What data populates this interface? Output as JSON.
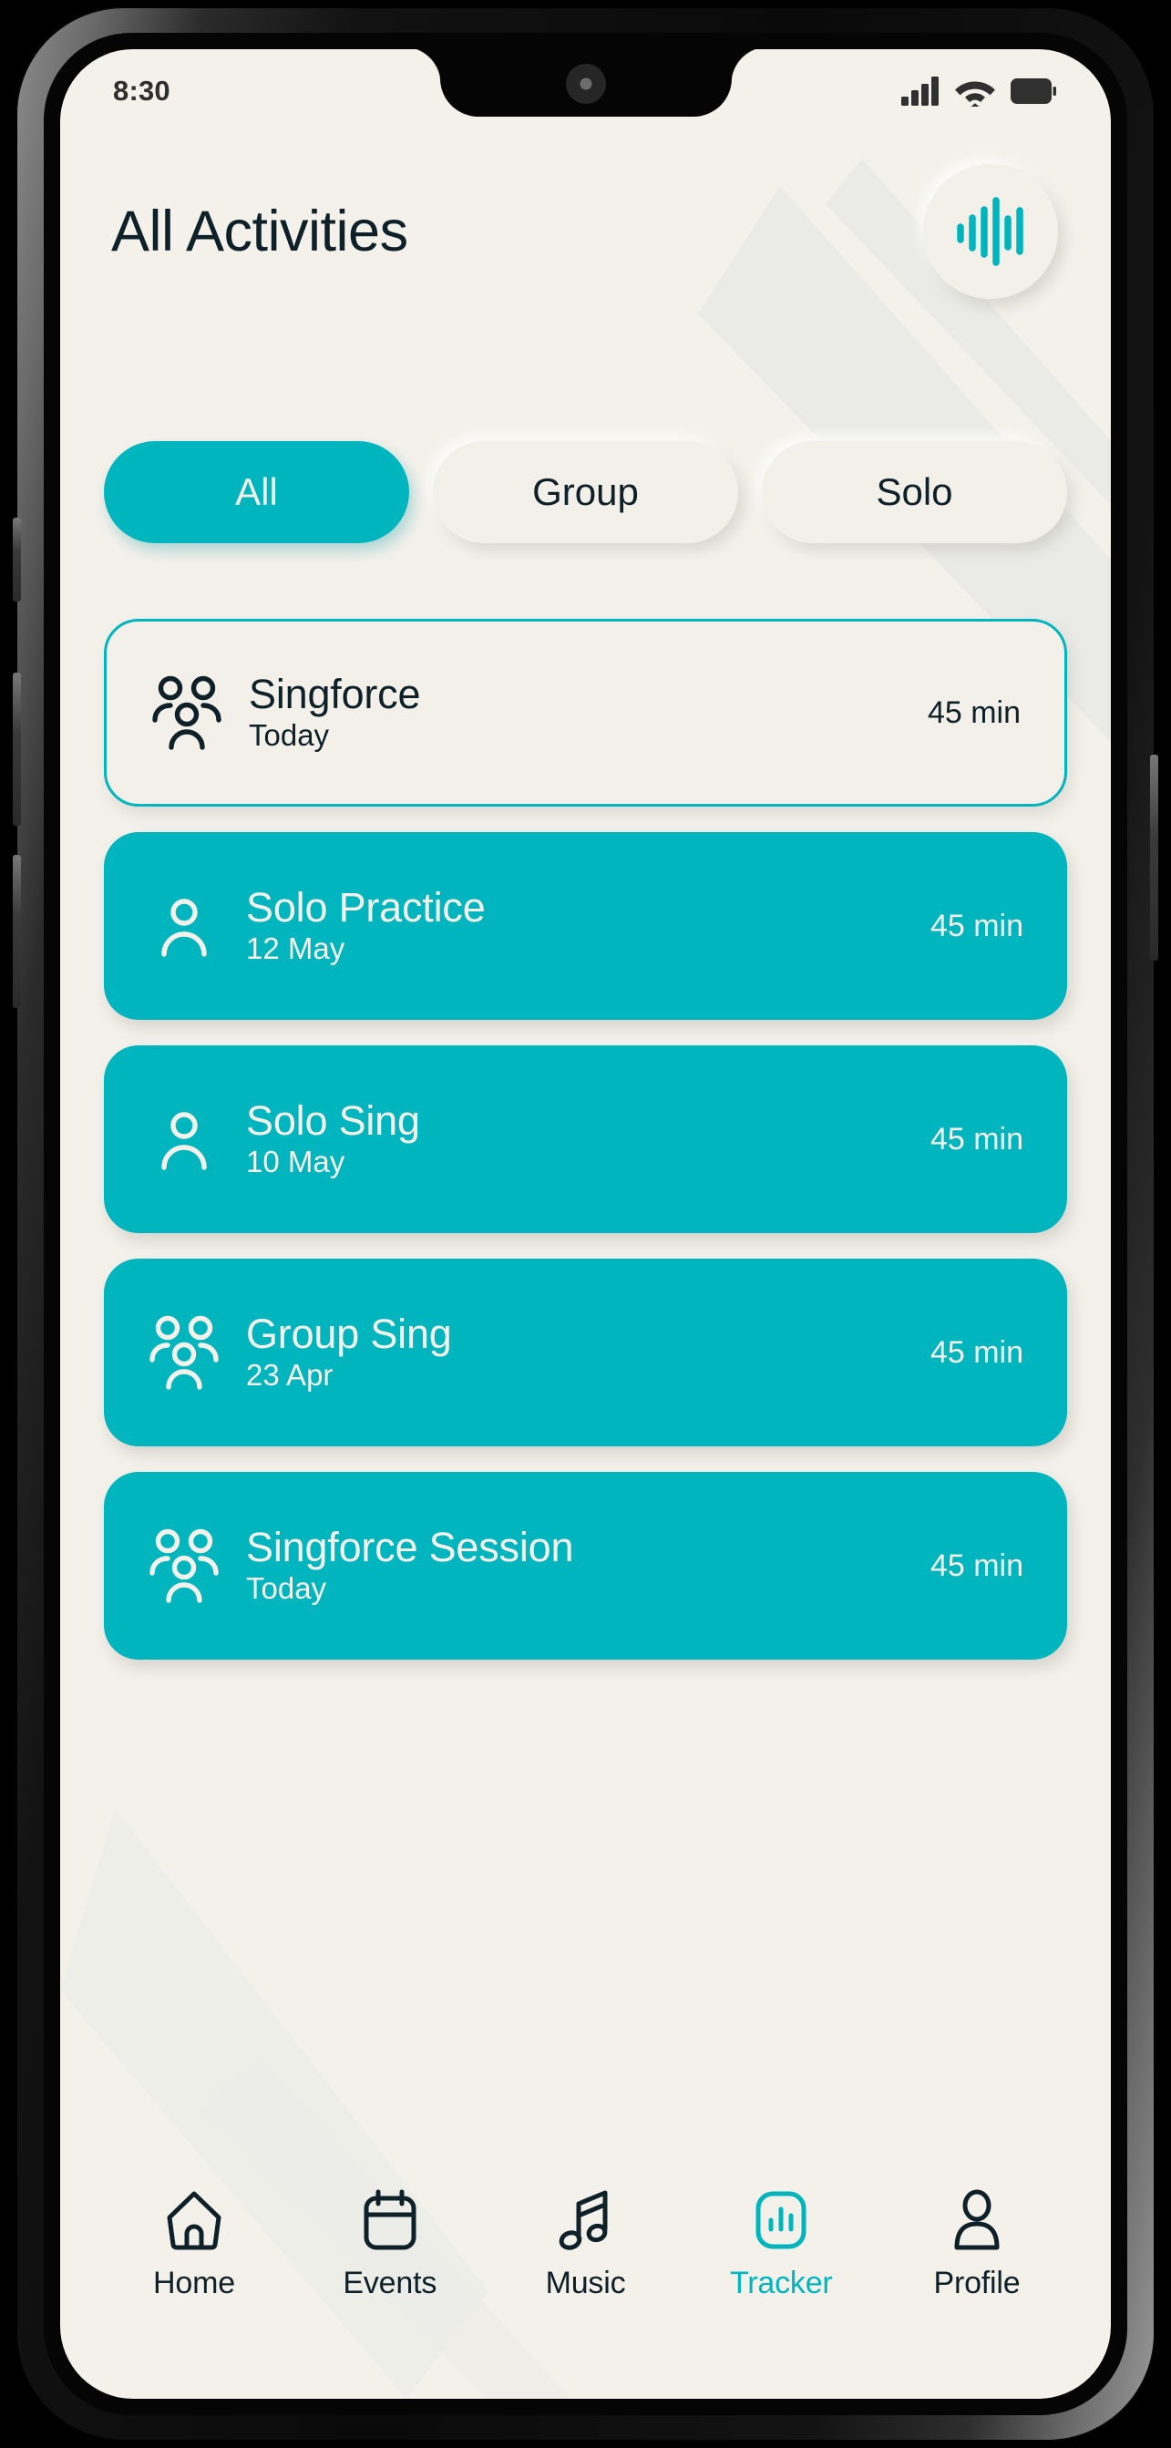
{
  "status_bar": {
    "time": "8:30",
    "icons": [
      "signal-icon",
      "wifi-icon",
      "battery-icon"
    ]
  },
  "header": {
    "title": "All Activities",
    "action_icon": "waveform-icon"
  },
  "filters": {
    "options": [
      {
        "label": "All",
        "active": true
      },
      {
        "label": "Group",
        "active": false
      },
      {
        "label": "Solo",
        "active": false
      }
    ]
  },
  "activities": [
    {
      "title": "Singforce",
      "date": "Today",
      "duration": "45 min",
      "icon": "group-icon",
      "style": "outlined"
    },
    {
      "title": "Solo Practice",
      "date": "12 May",
      "duration": "45 min",
      "icon": "person-icon",
      "style": "filled"
    },
    {
      "title": "Solo Sing",
      "date": "10 May",
      "duration": "45 min",
      "icon": "person-icon",
      "style": "filled"
    },
    {
      "title": "Group Sing",
      "date": "23 Apr",
      "duration": "45 min",
      "icon": "group-icon",
      "style": "filled"
    },
    {
      "title": "Singforce Session",
      "date": "Today",
      "duration": "45 min",
      "icon": "group-icon",
      "style": "filled"
    }
  ],
  "bottom_nav": {
    "items": [
      {
        "label": "Home",
        "icon": "home-icon",
        "active": false
      },
      {
        "label": "Events",
        "icon": "calendar-icon",
        "active": false
      },
      {
        "label": "Music",
        "icon": "music-icon",
        "active": false
      },
      {
        "label": "Tracker",
        "icon": "tracker-icon",
        "active": true
      },
      {
        "label": "Profile",
        "icon": "profile-icon",
        "active": false
      }
    ]
  },
  "colors": {
    "accent": "#00B5BD",
    "background": "#F4F1EB",
    "ink": "#0E2028",
    "on_accent": "#F4F1EB",
    "frame": "#0A0A0A"
  }
}
